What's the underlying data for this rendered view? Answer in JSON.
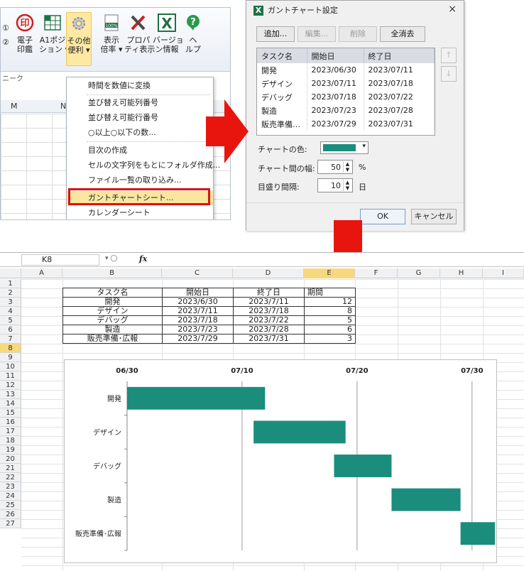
{
  "ribbon": {
    "buttons": [
      {
        "label1": "電子",
        "label2": "印鑑",
        "icon": "seal-icon"
      },
      {
        "label1": "A1ポジ",
        "label2": "ション ▾",
        "icon": "a1-position-icon"
      },
      {
        "label1": "その他",
        "label2": "便利 ▾",
        "icon": "gear-icon"
      },
      {
        "label1": "表示",
        "label2": "倍率 ▾",
        "icon": "zoom-100-icon"
      },
      {
        "label1": "プロパ",
        "label2": "ティ表示",
        "icon": "properties-icon"
      },
      {
        "label1": "バージョ",
        "label2": "ン情報",
        "icon": "excel-version-icon"
      },
      {
        "label1": "ヘ",
        "label2": "ルプ",
        "icon": "help-icon"
      }
    ],
    "left_markers": [
      "①",
      "②"
    ],
    "zoom_icon_text": "100%",
    "group_label": "ニーク",
    "columns": [
      "M",
      "N"
    ]
  },
  "menu": {
    "items": [
      "時間を数値に変換",
      "並び替え可能列番号",
      "並び替え可能行番号",
      "○以上○以下の数...",
      "目次の作成",
      "セルの文字列をもとにフォルダ作成...",
      "ファイル一覧の取り込み...",
      "ガントチャートシート...",
      "カレンダーシート"
    ],
    "selected_index": 7
  },
  "dialog": {
    "title": "ガントチャート設定",
    "close": "×",
    "buttons": {
      "add": "追加...",
      "edit": "編集...",
      "delete": "削除",
      "clear_all": "全消去"
    },
    "list_headers": [
      "タスク名",
      "開始日",
      "終了日"
    ],
    "list_rows": [
      [
        "開発",
        "2023/06/30",
        "2023/07/11"
      ],
      [
        "デザイン",
        "2023/07/11",
        "2023/07/18"
      ],
      [
        "デバッグ",
        "2023/07/18",
        "2023/07/22"
      ],
      [
        "製造",
        "2023/07/23",
        "2023/07/28"
      ],
      [
        "販売準備…",
        "2023/07/29",
        "2023/07/31"
      ]
    ],
    "up_arrow": "↑",
    "down_arrow": "↓",
    "chart_color_label": "チャートの色:",
    "chart_color": "#1b8d7c",
    "gap_label": "チャート間の幅:",
    "gap_value": "50",
    "gap_unit": "%",
    "tick_label": "目盛り間隔:",
    "tick_value": "10",
    "tick_unit": "日",
    "ok": "OK",
    "cancel": "キャンセル"
  },
  "sheet": {
    "name_box": "K8",
    "fx": "fx",
    "columns": [
      "A",
      "B",
      "C",
      "D",
      "E",
      "F",
      "G",
      "H",
      "I"
    ],
    "active_column": "E",
    "rows": [
      "1",
      "2",
      "3",
      "4",
      "5",
      "6",
      "7",
      "8",
      "9",
      "10",
      "11",
      "12",
      "13",
      "14",
      "15",
      "16",
      "17",
      "18",
      "19",
      "20",
      "21",
      "22",
      "23",
      "24",
      "25",
      "26",
      "27"
    ],
    "active_row": "8",
    "table": {
      "headers": [
        "タスク名",
        "開始日",
        "終了日",
        "期間"
      ],
      "rows": [
        [
          "開発",
          "2023/6/30",
          "2023/7/11",
          "12"
        ],
        [
          "デザイン",
          "2023/7/11",
          "2023/7/18",
          "8"
        ],
        [
          "デバッグ",
          "2023/7/18",
          "2023/7/22",
          "5"
        ],
        [
          "製造",
          "2023/7/23",
          "2023/7/28",
          "6"
        ],
        [
          "販売準備･広報",
          "2023/7/29",
          "2023/7/31",
          "3"
        ]
      ]
    }
  },
  "chart_data": {
    "type": "bar",
    "orientation": "horizontal-gantt",
    "categories": [
      "開発",
      "デザイン",
      "デバッグ",
      "製造",
      "販売準備･広報"
    ],
    "start": [
      "2023-06-30",
      "2023-07-11",
      "2023-07-18",
      "2023-07-23",
      "2023-07-29"
    ],
    "duration_days": [
      12,
      8,
      5,
      6,
      3
    ],
    "x_ticks": [
      "06/30",
      "07/10",
      "07/20",
      "07/30"
    ],
    "xlim": [
      "2023-06-30",
      "2023-07-31"
    ],
    "grid": true,
    "color": "#1b8d7c"
  }
}
